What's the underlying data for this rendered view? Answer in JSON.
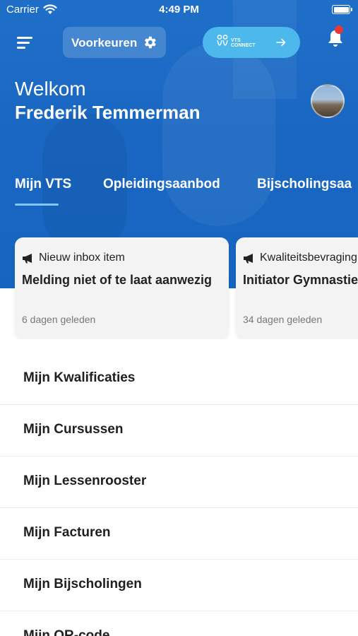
{
  "status_bar": {
    "carrier": "Carrier",
    "time": "4:49 PM"
  },
  "header": {
    "preferences_label": "Voorkeuren",
    "connect_label_line1": "VTS",
    "connect_label_line2": "CONNECT",
    "welcome": "Welkom",
    "user_name": "Frederik Temmerman"
  },
  "tabs": [
    {
      "label": "Mijn VTS",
      "active": true
    },
    {
      "label": "Opleidingsaanbod",
      "active": false
    },
    {
      "label": "Bijscholingsaa",
      "active": false
    }
  ],
  "cards": [
    {
      "category": "Nieuw inbox item",
      "title": "Melding niet of te laat aanwezig",
      "time": "6 dagen geleden"
    },
    {
      "category": "Kwaliteitsbevraging",
      "title": "Initiator Gymnastie",
      "time": "34 dagen geleden"
    }
  ],
  "menu_items": [
    "Mijn Kwalificaties",
    "Mijn Cursussen",
    "Mijn Lessenrooster",
    "Mijn Facturen",
    "Mijn Bijscholingen",
    "Mijn QR-code"
  ],
  "colors": {
    "primary": "#1a67c2",
    "accent": "#4cb8ec",
    "notification": "#e53935"
  },
  "icons": [
    "wifi-icon",
    "battery-icon",
    "menu-icon",
    "gear-icon",
    "vts-logo-icon",
    "arrow-right-icon",
    "bell-icon",
    "megaphone-icon"
  ]
}
